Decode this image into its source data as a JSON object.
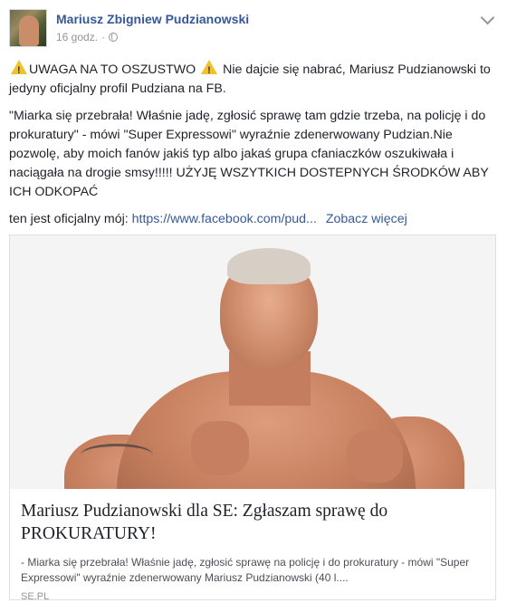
{
  "post": {
    "author": "Mariusz Zbigniew Pudzianowski",
    "time": "16 godz.",
    "separator": "·",
    "privacy_icon": "globe-icon",
    "menu_icon": "chevron-down-icon"
  },
  "text": {
    "p1_a": "UWAGA NA TO OSZUSTWO",
    "p1_b": "Nie dajcie się nabrać, Mariusz Pudzianowski to jedyny oficjalny profil Pudziana na FB.",
    "p2": "\"Miarka się przebrała! Właśnie jadę, zgłosić sprawę tam gdzie trzeba, na policję i do prokuratury\" - mówi \"Super Expressowi\" wyraźnie zdenerwowany Pudzian.Nie pozwolę, aby moich fanów jakiś typ albo jakaś grupa cfaniaczków oszukiwała i naciągała na drogie smsy!!!!! UŻYJĘ WSZYTKICH DOSTEPNYCH ŚRODKÓW ABY ICH ODKOPAĆ",
    "p3_prefix": "ten jest oficjalny mój:",
    "p3_link": "https://www.facebook.com/pud...",
    "see_more": "Zobacz więcej",
    "warning_icon": "warning-icon"
  },
  "card": {
    "title": "Mariusz Pudzianowski dla SE: Zgłaszam sprawę do PROKURATURY!",
    "description": "- Miarka się przebrała! Właśnie jadę, zgłosić sprawę na policję i do prokuratury - mówi \"Super Expressowi\" wyraźnie zdenerwowany Mariusz Pudzianowski (40 l....",
    "domain": "SE.PL"
  },
  "colors": {
    "link": "#365899",
    "text": "#1d2129",
    "meta": "#90949c",
    "warning": "#f2c12e"
  }
}
